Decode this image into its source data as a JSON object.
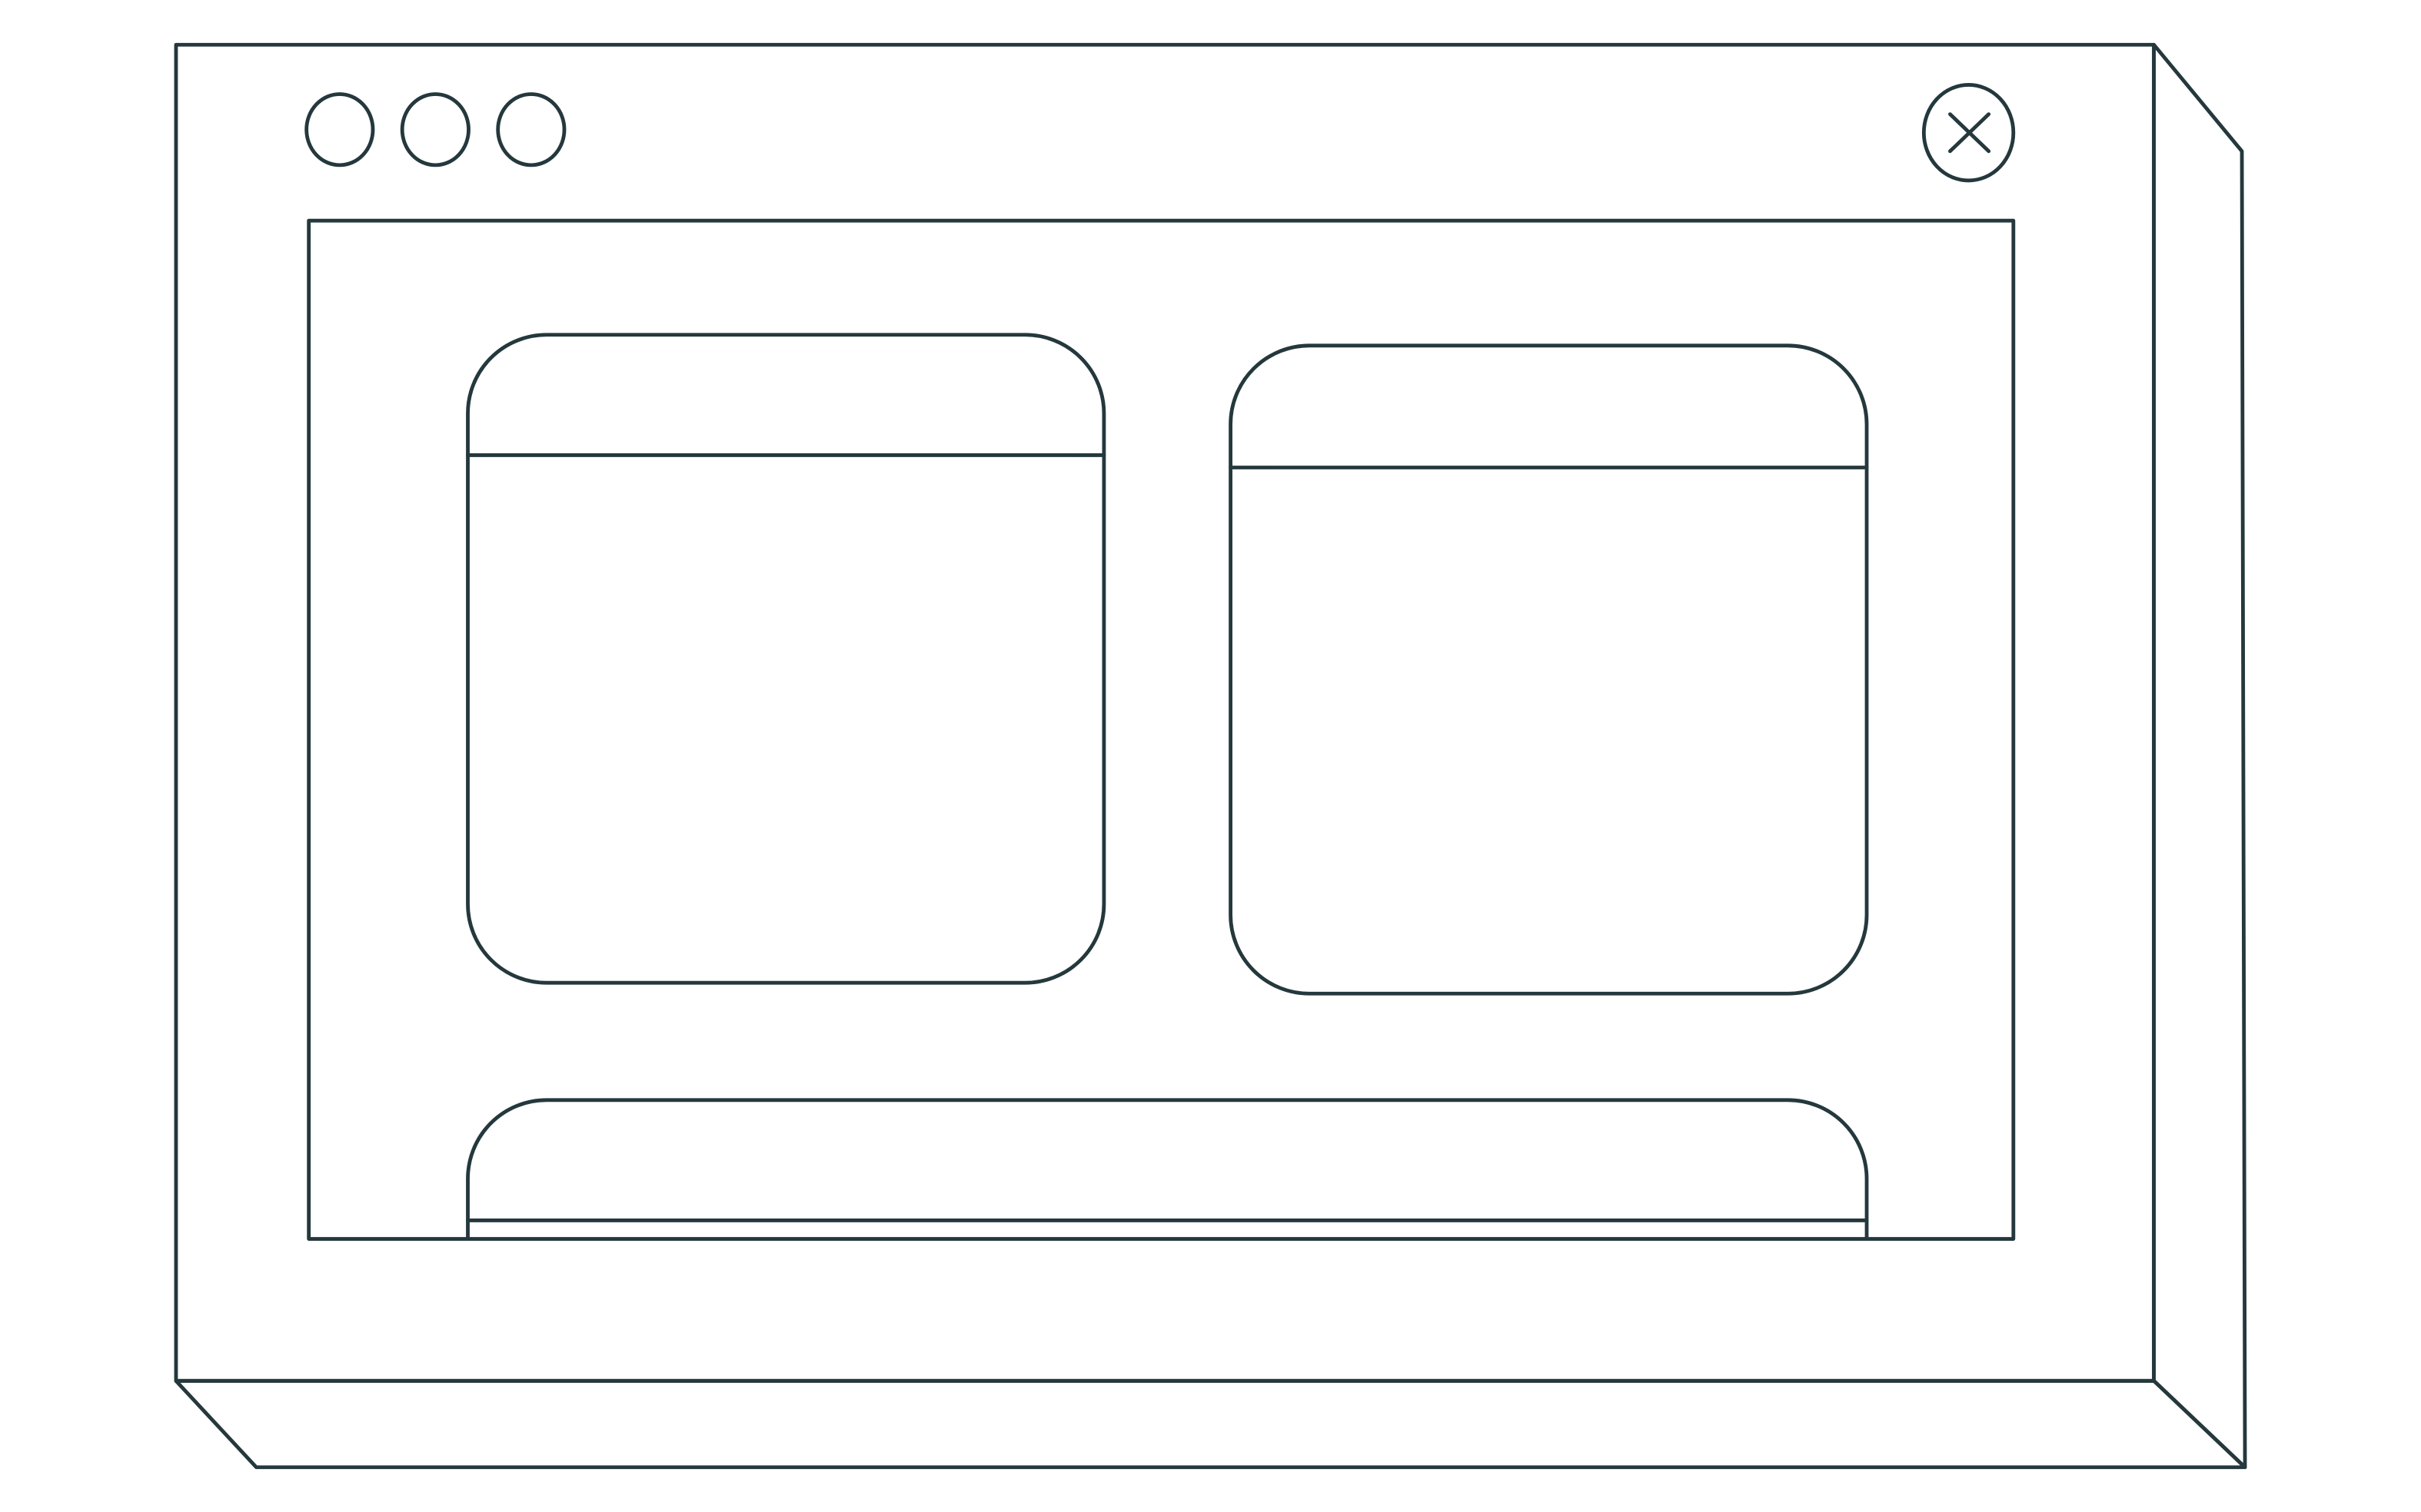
{
  "illustration": {
    "style": "line-art",
    "background_color": "#ffffff",
    "line_color": "#24383D"
  },
  "window": {
    "perspective": "3d-box-extruded-right-bottom",
    "controls": {
      "traffic_lights": [
        {
          "name": "window-dot-1"
        },
        {
          "name": "window-dot-2"
        },
        {
          "name": "window-dot-3"
        }
      ],
      "close_icon": "close-icon"
    },
    "content": {
      "cards": [
        {
          "name": "card-top-left",
          "has_header_bar": true
        },
        {
          "name": "card-top-right",
          "has_header_bar": true
        },
        {
          "name": "card-bottom-wide",
          "has_header_bar": true,
          "clipped_by_viewport": true
        }
      ]
    }
  }
}
